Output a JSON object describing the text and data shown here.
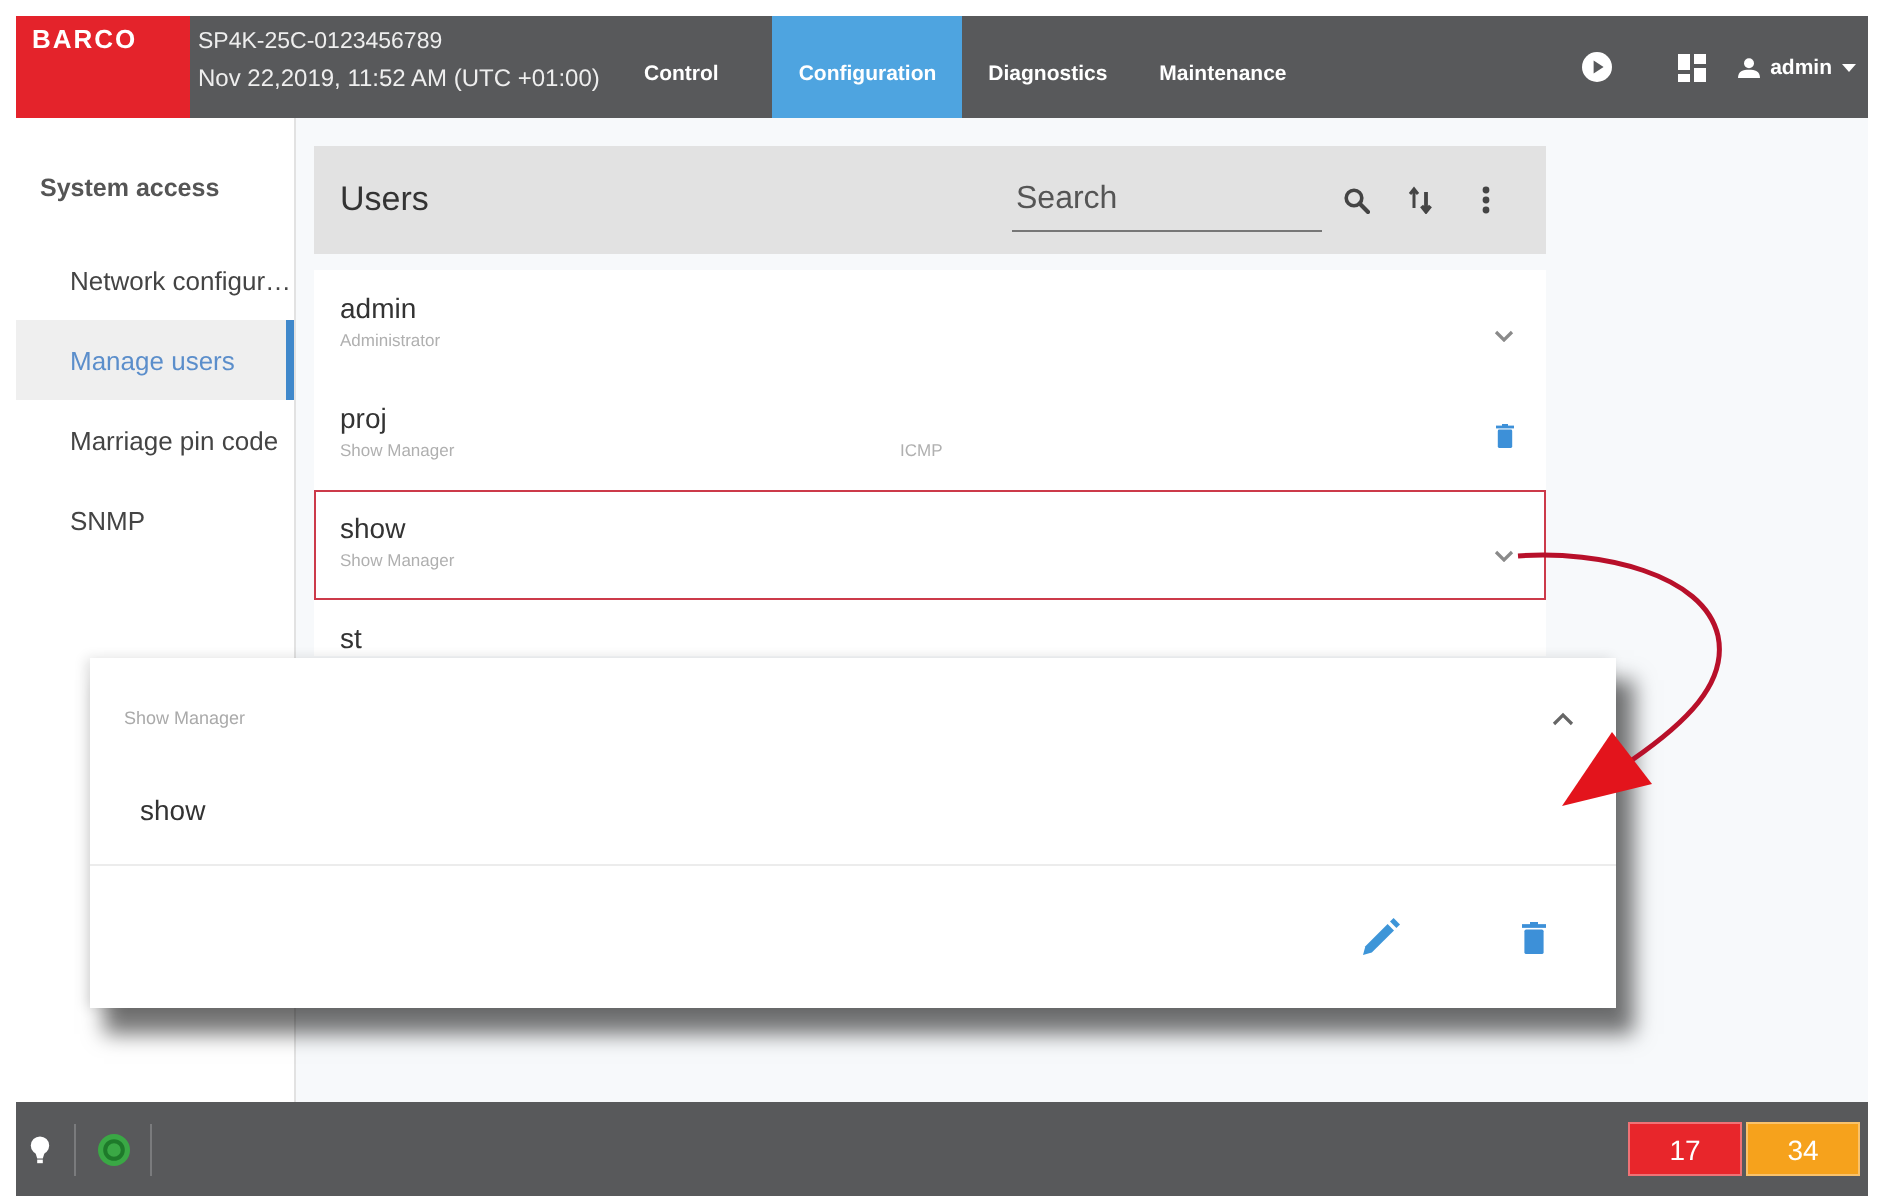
{
  "header": {
    "logo": "BARCO",
    "device": "SP4K-25C-0123456789",
    "datetime": "Nov 22,2019, 11:52 AM (UTC +01:00)",
    "tabs": [
      {
        "label": "Control",
        "selected": false
      },
      {
        "label": "Configuration",
        "selected": true
      },
      {
        "label": "Diagnostics",
        "selected": false
      },
      {
        "label": "Maintenance",
        "selected": false
      }
    ],
    "user": "admin"
  },
  "sidebar": {
    "title": "System access",
    "items": [
      {
        "label": "Network configur…",
        "selected": false
      },
      {
        "label": "Manage users",
        "selected": true
      },
      {
        "label": "Marriage pin code",
        "selected": false
      },
      {
        "label": "SNMP",
        "selected": false
      }
    ]
  },
  "users": {
    "title": "Users",
    "search": {
      "placeholder": "Search"
    },
    "rows": [
      {
        "name": "admin",
        "role": "Administrator",
        "kind": "expand",
        "highlighted": false
      },
      {
        "name": "proj",
        "role": "Show Manager",
        "column_3": "ICMP",
        "kind": "delete",
        "highlighted": false
      },
      {
        "name": "show",
        "role": "Show Manager",
        "kind": "expand",
        "highlighted": true
      },
      {
        "name": "st",
        "highlighted": false
      }
    ]
  },
  "detail_card": {
    "role": "Show Manager",
    "name": "show"
  },
  "status_bar": {
    "badges": [
      {
        "count": "17",
        "color": "#e8262b"
      },
      {
        "count": "34",
        "color": "#f6a21c"
      }
    ]
  }
}
